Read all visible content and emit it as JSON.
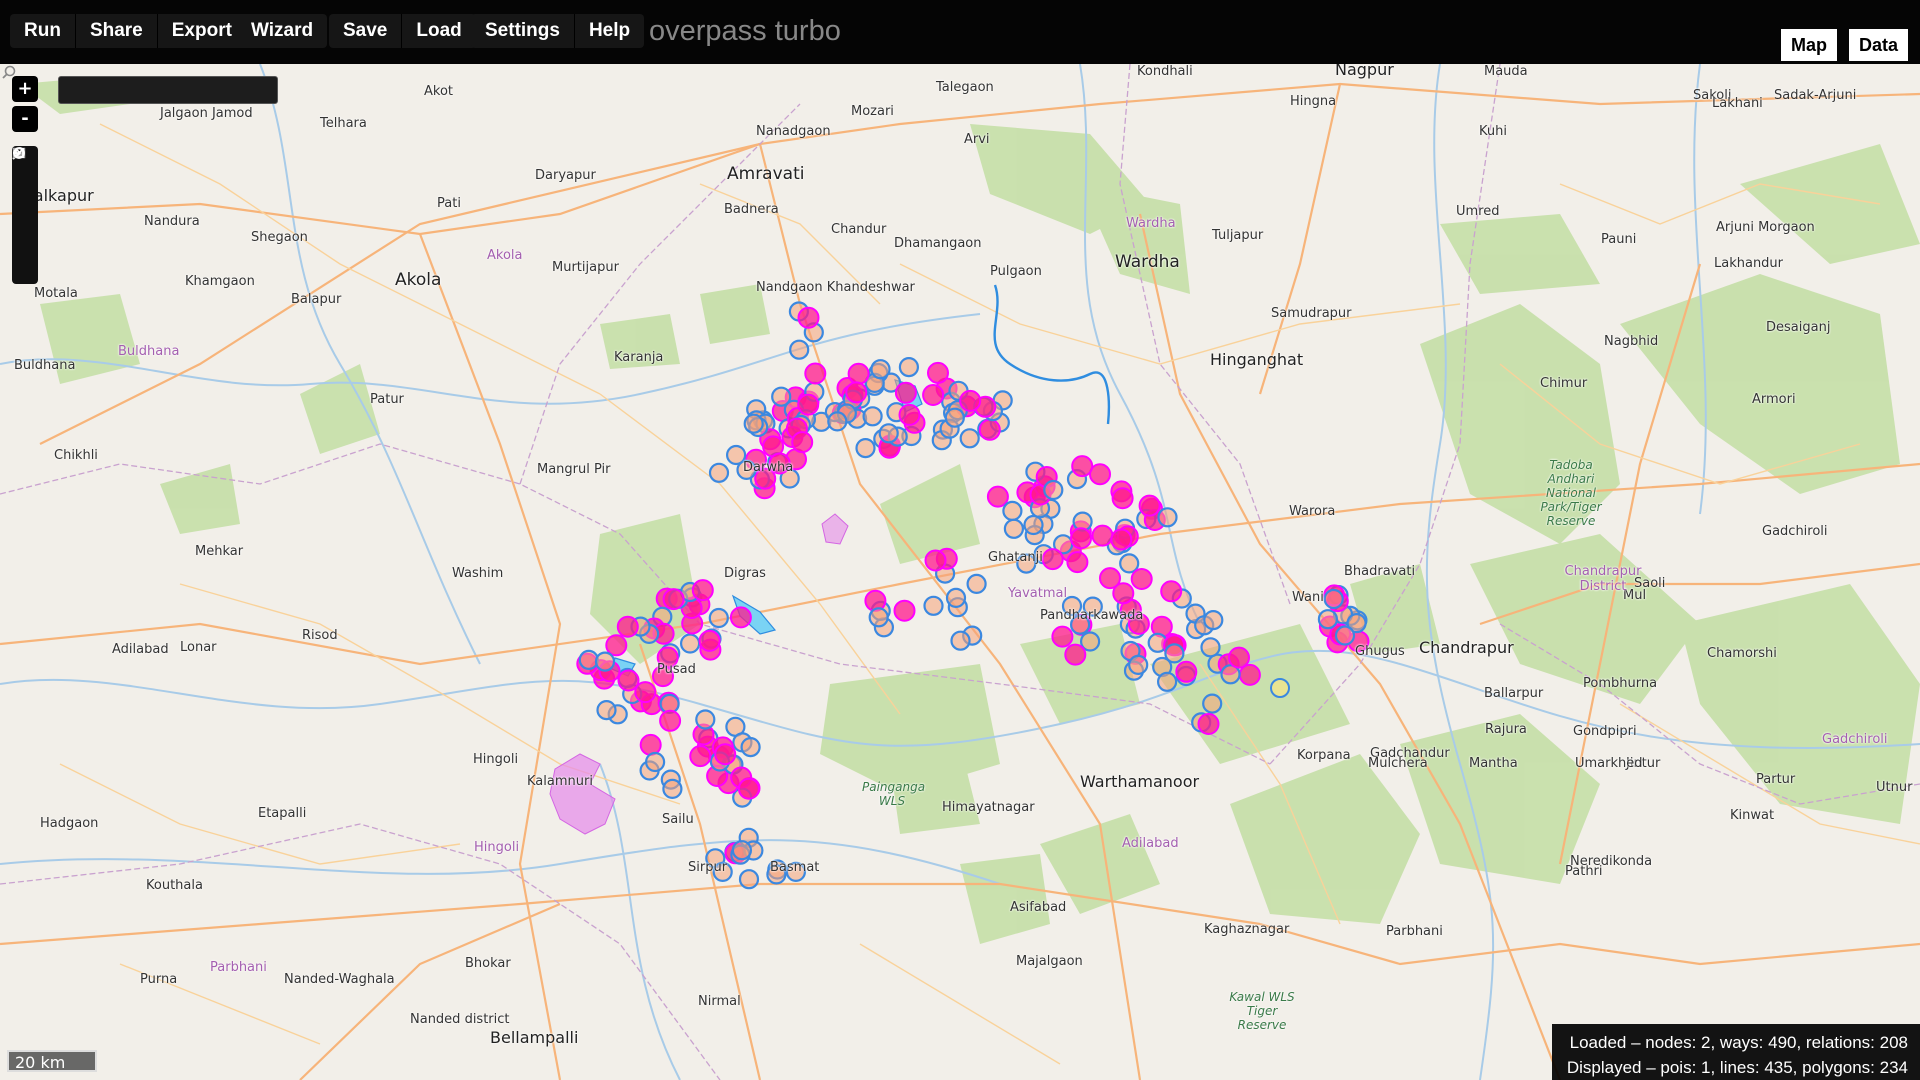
{
  "toolbar": {
    "run": "Run",
    "share": "Share",
    "export": "Export",
    "wizard": "Wizard",
    "save": "Save",
    "load": "Load",
    "settings": "Settings",
    "help": "Help"
  },
  "app_title": "overpass turbo",
  "view_switch": {
    "map": "Map",
    "data": "Data"
  },
  "map": {
    "search_placeholder": "",
    "zoom_in": "+",
    "zoom_out": "-",
    "scale_label": "20 km",
    "places": [
      "Akot",
      "Jalgaon Jamod",
      "Telhara",
      "Amravati",
      "Talegaon",
      "Mozari",
      "Nanadgaon",
      "Kondhali",
      "Nagpur",
      "Mauda",
      "Hingna",
      "Kuhi",
      "Sakoli",
      "Sadak-Arjuni",
      "Lakhani",
      "Malkapur",
      "Nandura",
      "Shegaon",
      "Pati",
      "Daryapur",
      "Badnera",
      "Chandur",
      "Dhamangaon",
      "Arvi",
      "Wardha",
      "Tuljapur",
      "Umred",
      "Pauni",
      "Arjuni Morgaon",
      "Akola",
      "Murtijapur",
      "Khamgaon",
      "Balapur",
      "Motala",
      "Buldhana",
      "Pulgaon",
      "Nandgaon Khandeshwar",
      "Samudrapur",
      "Hinganghat",
      "Nagbhid",
      "Lakhandur",
      "Desaiganj",
      "Karanja",
      "Patur",
      "Chikhli",
      "Mangrul Pir",
      "Darwha",
      "Chimur",
      "Armori",
      "Digras",
      "Warora",
      "Mehkar",
      "Washim",
      "Ghatanji",
      "Wani",
      "Bhadravati",
      "Chandrapur",
      "Lonar",
      "Risod",
      "Pusad",
      "Pandharkawada",
      "Ghugus",
      "Gadchiroli",
      "Saoli",
      "Mul",
      "Chamorshi",
      "Ballarpur",
      "Pombhurna",
      "Hingoli",
      "Kalamnuri",
      "Korpana",
      "Gadchandur",
      "Rajura",
      "Gondpipri",
      "Mulchera",
      "Mantha",
      "Jintur",
      "Partur",
      "Umarkhed",
      "Kinwat",
      "Adilabad",
      "Etapalli",
      "Hadgaon",
      "Sailu",
      "Himayatnagar",
      "Warthamanoor",
      "Utnur",
      "Sirpur",
      "Kouthala",
      "Basmat",
      "Asifabad",
      "Kaghaznagar",
      "Pathri",
      "Parbhani",
      "Neredikonda",
      "Bhokar",
      "Purna",
      "Nanded-Waghala",
      "Majalgaon",
      "Nirmal",
      "Nanded district",
      "Bellampalli"
    ],
    "district_labels": [
      "Akola",
      "Buldhana",
      "Wardha",
      "Yavatmal",
      "Hingoli",
      "Parbhani",
      "Adilabad",
      "Gadchiroli",
      "Chandrapur District"
    ],
    "protected_areas": [
      "Tadoba Andhari National Park/Tiger Reserve",
      "Painganga WLS",
      "Kawal WLS Tiger Reserve"
    ],
    "overlay_colors": {
      "way_outline": "#3b88e0",
      "way_fill": "#f5a27a",
      "poi": "#ff1a8c",
      "poi_stroke": "#ff00ff",
      "relation_fill": "#e58aea",
      "water_line": "#2f8de0"
    },
    "layer_icons": [
      "magnifier-icon",
      "circle-icon",
      "image-icon",
      "export-icon",
      "no-entry-icon"
    ]
  },
  "status": {
    "loaded": "Loaded – nodes: 2, ways: 490, relations: 208",
    "displayed": "Displayed – pois: 1, lines: 435, polygons: 234"
  }
}
